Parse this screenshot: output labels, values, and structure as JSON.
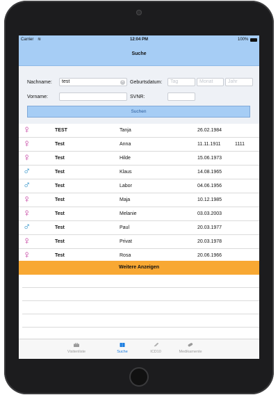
{
  "statusbar": {
    "carrier": "Carrier",
    "time": "12:04 PM",
    "battery": "100%"
  },
  "navbar": {
    "title": "Suche"
  },
  "form": {
    "nachname_label": "Nachname:",
    "nachname_value": "test",
    "vorname_label": "Vorname:",
    "vorname_value": "",
    "geburtsdatum_label": "Geburtsdatum:",
    "tag_placeholder": "Tag",
    "monat_placeholder": "Monat",
    "jahr_placeholder": "Jahr",
    "svnr_label": "SVNR:",
    "svnr_value": "",
    "search_button": "Suchen"
  },
  "results": [
    {
      "gender": "female",
      "symbol": "♀",
      "last": "TEST",
      "first": "Tanja",
      "dob": "26.02.1984",
      "extra": ""
    },
    {
      "gender": "female",
      "symbol": "♀",
      "last": "Test",
      "first": "Anna",
      "dob": "11.11.1911",
      "extra": "1111"
    },
    {
      "gender": "female",
      "symbol": "♀",
      "last": "Test",
      "first": "Hilde",
      "dob": "15.06.1973",
      "extra": ""
    },
    {
      "gender": "male",
      "symbol": "♂",
      "last": "Test",
      "first": "Klaus",
      "dob": "14.08.1965",
      "extra": ""
    },
    {
      "gender": "male",
      "symbol": "♂",
      "last": "Test",
      "first": "Labor",
      "dob": "04.06.1956",
      "extra": ""
    },
    {
      "gender": "female",
      "symbol": "♀",
      "last": "Test",
      "first": "Maja",
      "dob": "10.12.1985",
      "extra": ""
    },
    {
      "gender": "female",
      "symbol": "♀",
      "last": "Test",
      "first": "Melanie",
      "dob": "03.03.2003",
      "extra": ""
    },
    {
      "gender": "male",
      "symbol": "♂",
      "last": "Test",
      "first": "Paul",
      "dob": "20.03.1977",
      "extra": ""
    },
    {
      "gender": "female",
      "symbol": "♀",
      "last": "Test",
      "first": "Privat",
      "dob": "20.03.1978",
      "extra": ""
    },
    {
      "gender": "female",
      "symbol": "♀",
      "last": "Test",
      "first": "Rosa",
      "dob": "20.06.1966",
      "extra": ""
    }
  ],
  "more_button": "Weitere Anzeigen",
  "tabs": [
    {
      "label": "Visitenliste",
      "icon": "briefcase-icon",
      "active": false
    },
    {
      "label": "Suche",
      "icon": "book-icon",
      "active": true
    },
    {
      "label": "ICD10",
      "icon": "paperclip-icon",
      "active": false
    },
    {
      "label": "Medikamente",
      "icon": "pill-icon",
      "active": false
    }
  ],
  "colors": {
    "accent": "#1a7de0",
    "navbar": "#a6cdf5",
    "more_button": "#f8a833",
    "female": "#c2369c",
    "male": "#2a8fc7"
  }
}
